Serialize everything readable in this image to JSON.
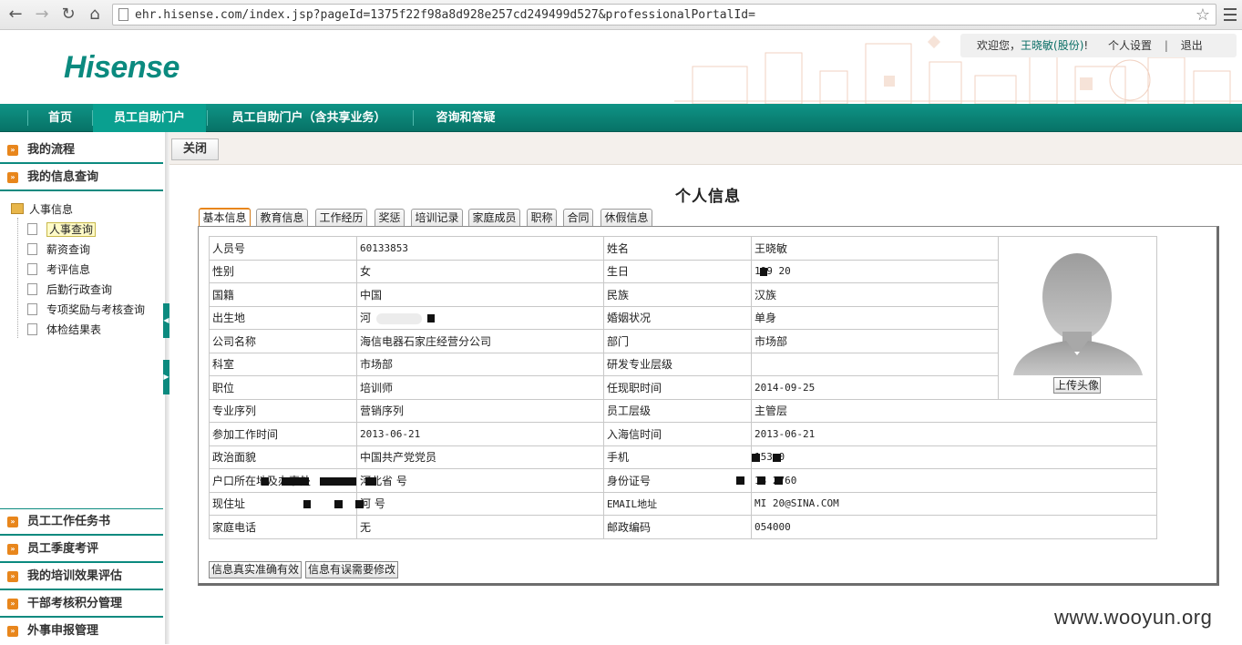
{
  "browser": {
    "url": "ehr.hisense.com/index.jsp?pageId=1375f22f98a8d928e257cd249499d527&professionalPortalId="
  },
  "header": {
    "logo": "Hisense",
    "welcome_prefix": "欢迎您，",
    "user_name": "王晓敏(股份)",
    "user_suffix": "!",
    "settings_label": "个人设置",
    "divider": "|",
    "logout_label": "退出"
  },
  "nav": {
    "items": [
      {
        "label": "首页"
      },
      {
        "label": "员工自助门户"
      },
      {
        "label": "员工自助门户（含共享业务）"
      },
      {
        "label": "咨询和答疑"
      }
    ]
  },
  "sidebar": {
    "top_sections": [
      {
        "label": "我的流程"
      },
      {
        "label": "我的信息查询"
      }
    ],
    "tree_root": "人事信息",
    "tree_items": [
      {
        "label": "人事查询"
      },
      {
        "label": "薪资查询"
      },
      {
        "label": "考评信息"
      },
      {
        "label": "后勤行政查询"
      },
      {
        "label": "专项奖励与考核查询"
      },
      {
        "label": "体检结果表"
      }
    ],
    "bottom_sections": [
      {
        "label": "员工工作任务书"
      },
      {
        "label": "员工季度考评"
      },
      {
        "label": "我的培训效果评估"
      },
      {
        "label": "干部考核积分管理"
      },
      {
        "label": "外事申报管理"
      }
    ]
  },
  "content": {
    "close_label": "关闭",
    "title": "个人信息",
    "tabs": [
      {
        "label": "基本信息"
      },
      {
        "label": "教育信息"
      },
      {
        "label": "工作经历"
      },
      {
        "label": "奖惩"
      },
      {
        "label": "培训记录"
      },
      {
        "label": "家庭成员"
      },
      {
        "label": "职称"
      },
      {
        "label": "合同"
      },
      {
        "label": "休假信息"
      }
    ],
    "upload_label": "上传头像",
    "rows": [
      {
        "l1": "人员号",
        "v1": "60133853",
        "l2": "姓名",
        "v2": "王晓敏"
      },
      {
        "l1": "性别",
        "v1": "女",
        "l2": "生日",
        "v2": "199 20"
      },
      {
        "l1": "国籍",
        "v1": "中国",
        "l2": "民族",
        "v2": "汉族"
      },
      {
        "l1": "出生地",
        "v1": "河",
        "l2": "婚姻状况",
        "v2": "单身"
      },
      {
        "l1": "公司名称",
        "v1": "海信电器石家庄经营分公司",
        "l2": "部门",
        "v2": "市场部"
      },
      {
        "l1": "科室",
        "v1": "市场部",
        "l2": "研发专业层级",
        "v2": ""
      },
      {
        "l1": "职位",
        "v1": "培训师",
        "l2": "任现职时间",
        "v2": "2014-09-25"
      },
      {
        "l1": "专业序列",
        "v1": "营销序列",
        "l2": "员工层级",
        "v2": "主管层"
      },
      {
        "l1": "参加工作时间",
        "v1": "2013-06-21",
        "l2": "入海信时间",
        "v2": "2013-06-21"
      },
      {
        "l1": "政治面貌",
        "v1": "中国共产党党员",
        "l2": "手机",
        "v2": "153 0"
      },
      {
        "l1": "户口所在地及办事处",
        "v1": "河北省 号",
        "l2": "身份证号",
        "v2": "13 2760"
      },
      {
        "l1": "现住址",
        "v1": "河 号",
        "l2": "EMAIL地址",
        "v2": "MI 20@SINA.COM"
      },
      {
        "l1": "家庭电话",
        "v1": "无",
        "l2": "邮政编码",
        "v2": "054000"
      }
    ],
    "confirm_label": "信息真实准确有效",
    "error_label": "信息有误需要修改"
  },
  "watermark": "www.wooyun.org",
  "colors": {
    "brand_teal": "#0b8a7f",
    "accent_orange": "#e8861c"
  }
}
